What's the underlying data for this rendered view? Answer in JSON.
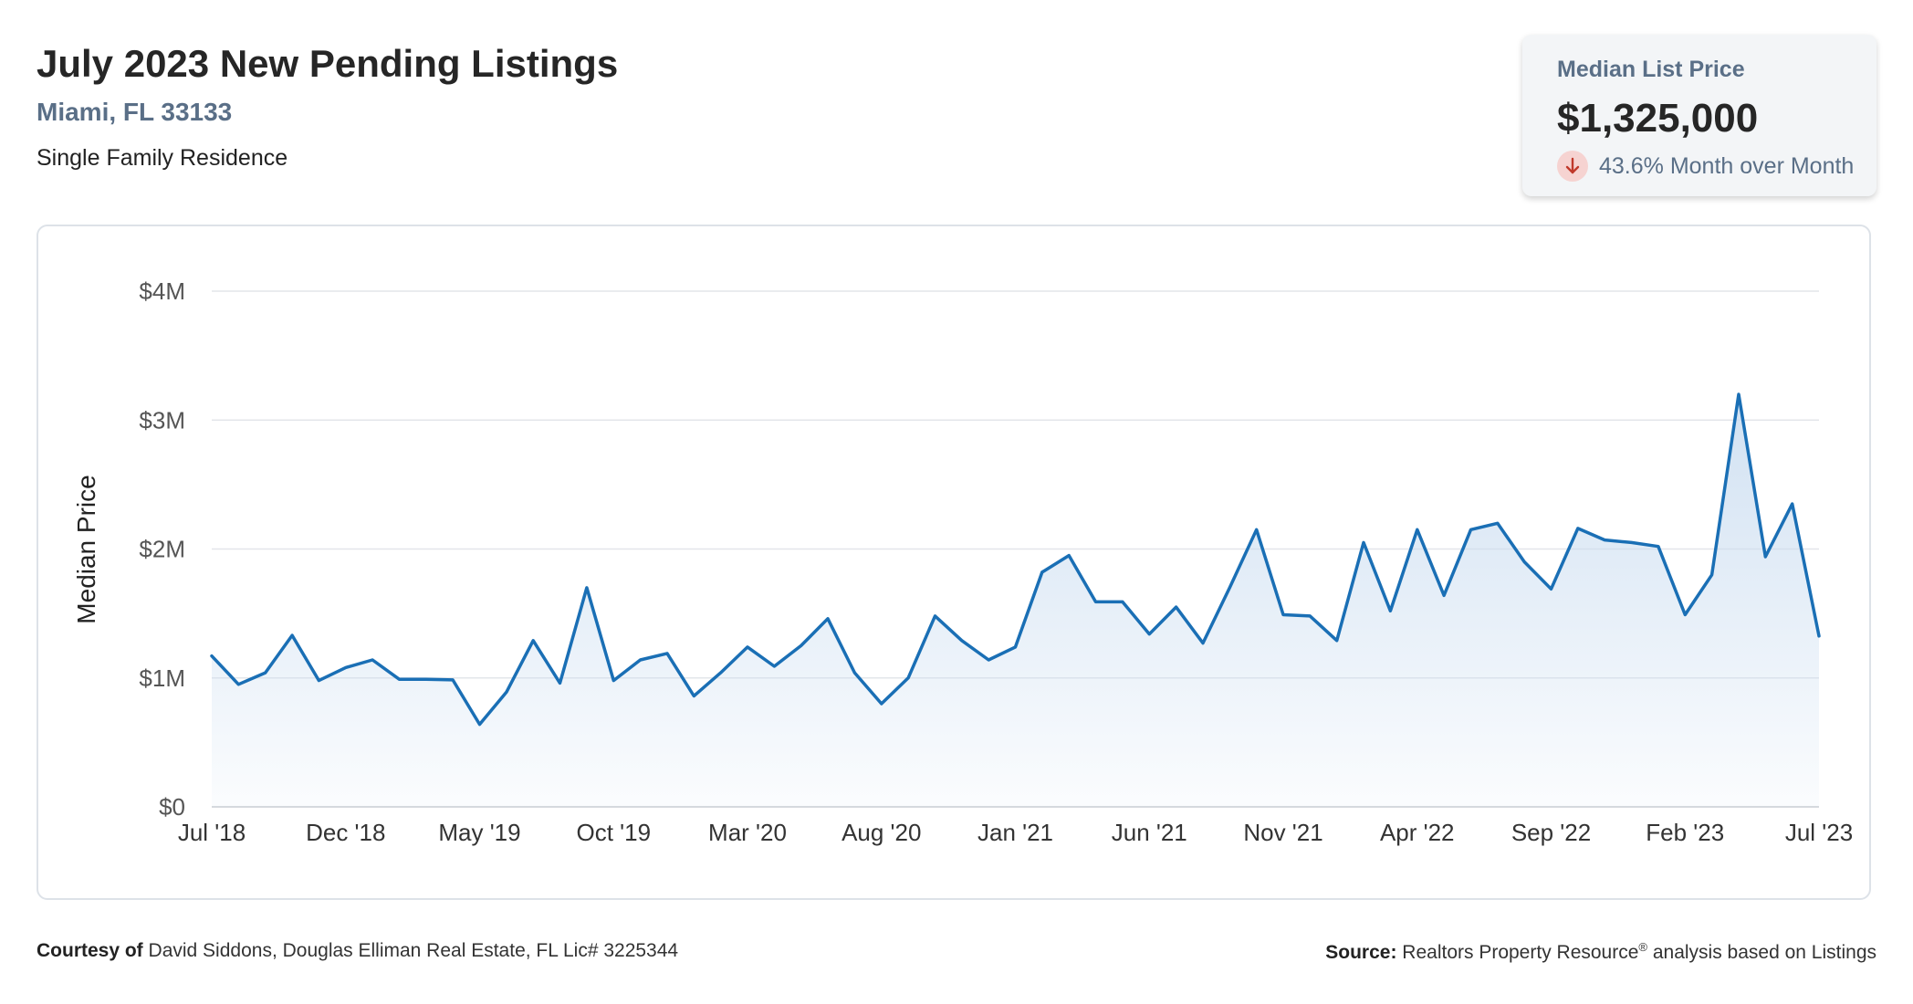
{
  "header": {
    "title": "July 2023 New Pending Listings",
    "location": "Miami, FL 33133",
    "property_type": "Single Family Residence"
  },
  "stat_card": {
    "label": "Median List Price",
    "value": "$1,325,000",
    "change": "43.6% Month over Month",
    "direction_icon": "arrow-down-icon",
    "direction_color": "#c0392b"
  },
  "footer": {
    "courtesy_label": "Courtesy of",
    "courtesy_text": "David Siddons, Douglas Elliman Real Estate, FL Lic# 3225344",
    "source_label": "Source:",
    "source_name": "Realtors Property Resource",
    "source_mark": "®",
    "source_suffix": "analysis based on Listings"
  },
  "chart_data": {
    "type": "area",
    "ylabel": "Median Price",
    "ylim": [
      0,
      4000000
    ],
    "yticks": [
      0,
      1000000,
      2000000,
      3000000,
      4000000
    ],
    "ytick_labels": [
      "$0",
      "$1M",
      "$2M",
      "$3M",
      "$4M"
    ],
    "x_tick_labels": [
      "Jul '18",
      "Dec '18",
      "May '19",
      "Oct '19",
      "Mar '20",
      "Aug '20",
      "Jan '21",
      "Jun '21",
      "Nov '21",
      "Apr '22",
      "Sep '22",
      "Feb '23",
      "Jul '23"
    ],
    "grid": true,
    "line_color": "#1a6fb5",
    "fill_color": "#c9dcf0",
    "series": [
      {
        "x": [
          "2018-07",
          "2018-08",
          "2018-09",
          "2018-10",
          "2018-11",
          "2018-12",
          "2019-01",
          "2019-02",
          "2019-03",
          "2019-04",
          "2019-05",
          "2019-06",
          "2019-07",
          "2019-08",
          "2019-09",
          "2019-10",
          "2019-11",
          "2019-12",
          "2020-01",
          "2020-02",
          "2020-03",
          "2020-04",
          "2020-05",
          "2020-06",
          "2020-07",
          "2020-08",
          "2020-09",
          "2020-10",
          "2020-11",
          "2020-12",
          "2021-01",
          "2021-02",
          "2021-03",
          "2021-04",
          "2021-05",
          "2021-06",
          "2021-07",
          "2021-08",
          "2021-09",
          "2021-10",
          "2021-11",
          "2021-12",
          "2022-01",
          "2022-02",
          "2022-03",
          "2022-04",
          "2022-05",
          "2022-06",
          "2022-07",
          "2022-08",
          "2022-09",
          "2022-10",
          "2022-11",
          "2022-12",
          "2023-01",
          "2023-02",
          "2023-03",
          "2023-04",
          "2023-05",
          "2023-06",
          "2023-07"
        ],
        "values": [
          1170000,
          950000,
          1040000,
          1330000,
          980000,
          1080000,
          1140000,
          990000,
          990000,
          985000,
          640000,
          890000,
          1290000,
          960000,
          1700000,
          980000,
          1140000,
          1190000,
          860000,
          1040000,
          1240000,
          1090000,
          1250000,
          1460000,
          1040000,
          800000,
          1000000,
          1480000,
          1290000,
          1140000,
          1240000,
          1820000,
          1950000,
          1590000,
          1590000,
          1340000,
          1550000,
          1270000,
          1700000,
          2150000,
          1490000,
          1480000,
          1290000,
          2050000,
          1520000,
          2150000,
          1640000,
          2150000,
          2200000,
          1900000,
          1690000,
          2160000,
          2070000,
          2050000,
          2020000,
          1490000,
          1800000,
          3200000,
          1940000,
          2350000,
          1325000
        ]
      }
    ]
  }
}
